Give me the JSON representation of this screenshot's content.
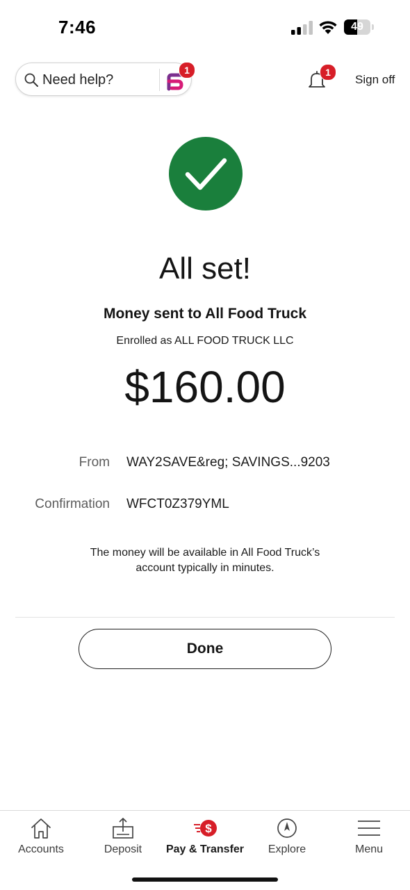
{
  "status_bar": {
    "time": "7:46",
    "battery_level": "49",
    "battery_fraction": 0.49
  },
  "header": {
    "help_placeholder": "Need help?",
    "assistant_badge": "1",
    "notification_badge": "1",
    "sign_off_label": "Sign off"
  },
  "confirmation": {
    "headline": "All set!",
    "title": "Money sent to All Food Truck",
    "enrolled_as": "Enrolled as ALL FOOD TRUCK LLC",
    "amount": "$160.00",
    "details": [
      {
        "label": "From",
        "value": "WAY2SAVE&reg; SAVINGS...9203"
      },
      {
        "label": "Confirmation",
        "value": "WFCT0Z379YML"
      }
    ],
    "availability_note": "The money will be available in All Food Truck’s account typically in minutes.",
    "done_label": "Done"
  },
  "nav": {
    "items": [
      {
        "label": "Accounts",
        "icon": "home-icon",
        "active": false
      },
      {
        "label": "Deposit",
        "icon": "deposit-icon",
        "active": false
      },
      {
        "label": "Pay & Transfer",
        "icon": "pay-transfer-icon",
        "active": true
      },
      {
        "label": "Explore",
        "icon": "compass-icon",
        "active": false
      },
      {
        "label": "Menu",
        "icon": "menu-icon",
        "active": false
      }
    ]
  },
  "colors": {
    "success_green": "#1a7f3c",
    "alert_red": "#d71e28",
    "assistant_purple": "#7b2f8e"
  }
}
